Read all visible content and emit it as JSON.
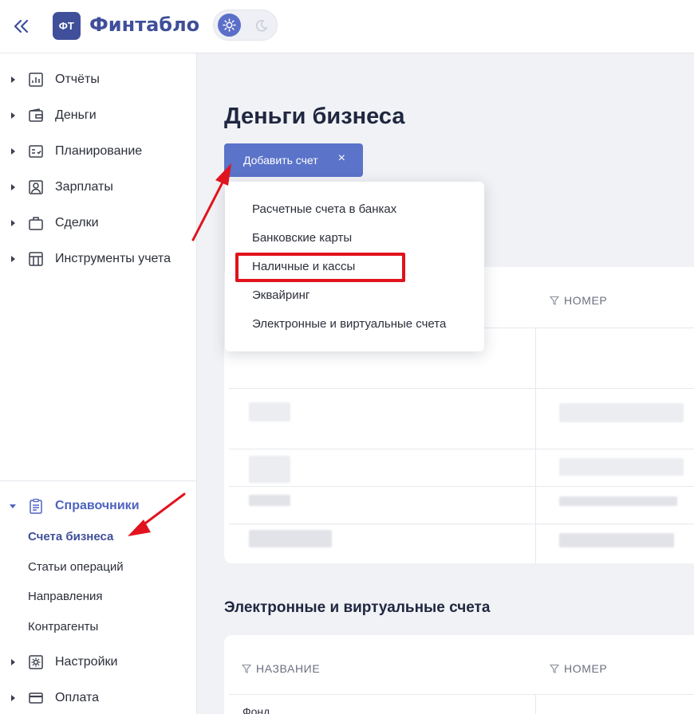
{
  "app": {
    "brand_badge": "ФТ",
    "brand_name": "Финтабло",
    "colors": {
      "brand": "#3f4f9a",
      "accent": "#5b73c9",
      "annotation": "#e0131e"
    }
  },
  "sidebar": {
    "items": [
      {
        "label": "Отчёты",
        "icon": "chart-icon"
      },
      {
        "label": "Деньги",
        "icon": "wallet-icon"
      },
      {
        "label": "Планирование",
        "icon": "checklist-icon"
      },
      {
        "label": "Зарплаты",
        "icon": "person-card-icon"
      },
      {
        "label": "Сделки",
        "icon": "briefcase-icon"
      },
      {
        "label": "Инструменты учета",
        "icon": "table-icon"
      }
    ],
    "reference": {
      "label": "Справочники",
      "icon": "clipboard-icon",
      "children": [
        "Счета бизнеса",
        "Статьи операций",
        "Направления",
        "Контрагенты"
      ],
      "active_child": "Счета бизнеса"
    },
    "bottom_items": [
      {
        "label": "Настройки",
        "icon": "settings-icon"
      },
      {
        "label": "Оплата",
        "icon": "card-icon"
      }
    ]
  },
  "main": {
    "title": "Деньги бизнеса",
    "add_button": "Добавить счет",
    "add_button_close": "×",
    "dropdown": [
      "Расчетные счета в банках",
      "Банковские карты",
      "Наличные и кассы",
      "Эквайринг",
      "Электронные и виртуальные счета"
    ],
    "highlighted_option": "Наличные и кассы",
    "table1": {
      "col_number": "НОМЕР"
    },
    "section2": {
      "title": "Электронные и виртуальные счета",
      "col_name": "НАЗВАНИЕ",
      "col_number": "НОМЕР",
      "first_row": "Фонд"
    }
  }
}
